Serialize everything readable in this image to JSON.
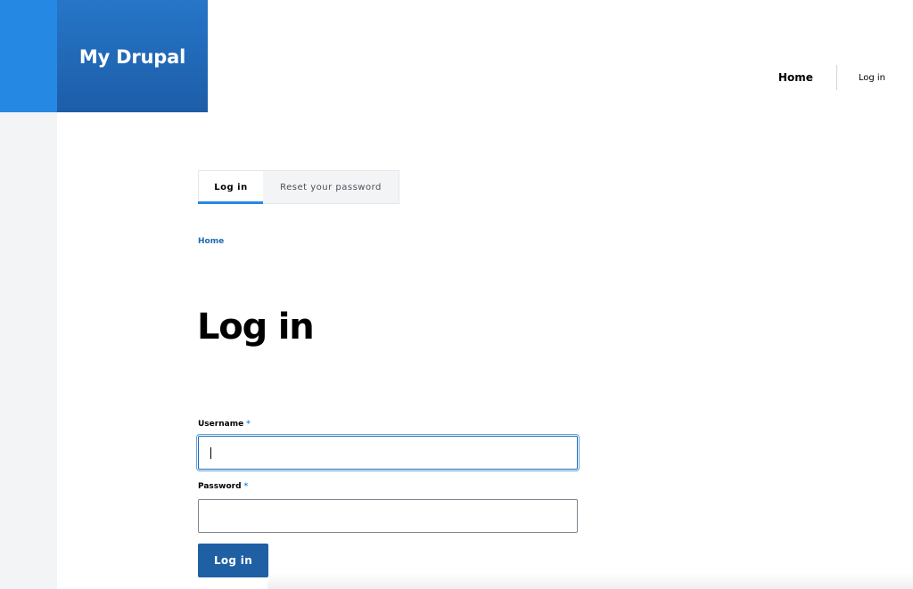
{
  "header": {
    "site_name": "My Drupal",
    "nav": {
      "home": "Home",
      "login": "Log in"
    }
  },
  "tabs": [
    {
      "label": "Log in",
      "active": true
    },
    {
      "label": "Reset your password",
      "active": false
    }
  ],
  "breadcrumb": {
    "home": "Home"
  },
  "page": {
    "title": "Log in"
  },
  "form": {
    "username": {
      "label": "Username",
      "required_marker": "*",
      "value": "",
      "focused": true
    },
    "password": {
      "label": "Password",
      "required_marker": "*",
      "value": ""
    },
    "submit_label": "Log in"
  },
  "colors": {
    "accent": "#2589e4",
    "brand_dark": "#1f5fa4",
    "link": "#1f68b1",
    "rail": "#f3f4f6"
  }
}
